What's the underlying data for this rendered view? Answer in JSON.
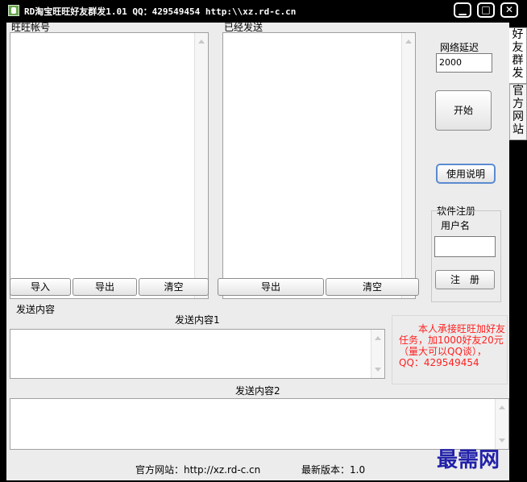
{
  "window": {
    "title": "RD淘宝旺旺好友群发1.01 QQ：429549454 http:\\\\xz.rd-c.cn",
    "minimize": "▁",
    "maximize": "□",
    "close": "✕"
  },
  "left_panel": {
    "label": "旺旺帐号",
    "buttons": [
      "导入",
      "导出",
      "清空"
    ]
  },
  "middle_panel": {
    "label": "已经发送",
    "buttons": [
      "导出",
      "清空"
    ]
  },
  "right_panel": {
    "delay_label": "网络延迟",
    "delay_value": "2000",
    "start_button": "开始",
    "help_button": "使用说明",
    "reg_group_label": "软件注册",
    "username_label": "用户名",
    "username_value": "",
    "register_button": "注　册"
  },
  "tabs": [
    "好友群发",
    "官方网站"
  ],
  "send": {
    "section_label": "发送内容",
    "content1_label": "发送内容1",
    "content1_value": "",
    "content2_label": "发送内容2",
    "content2_value": ""
  },
  "notice": "本人承接旺旺加好友任务，加1000好友20元（量大可以QQ谈），QQ：429549454",
  "footer": {
    "site": "官方网站：http://xz.rd-c.cn",
    "version": "最新版本：1.0"
  },
  "watermark": "最需网"
}
